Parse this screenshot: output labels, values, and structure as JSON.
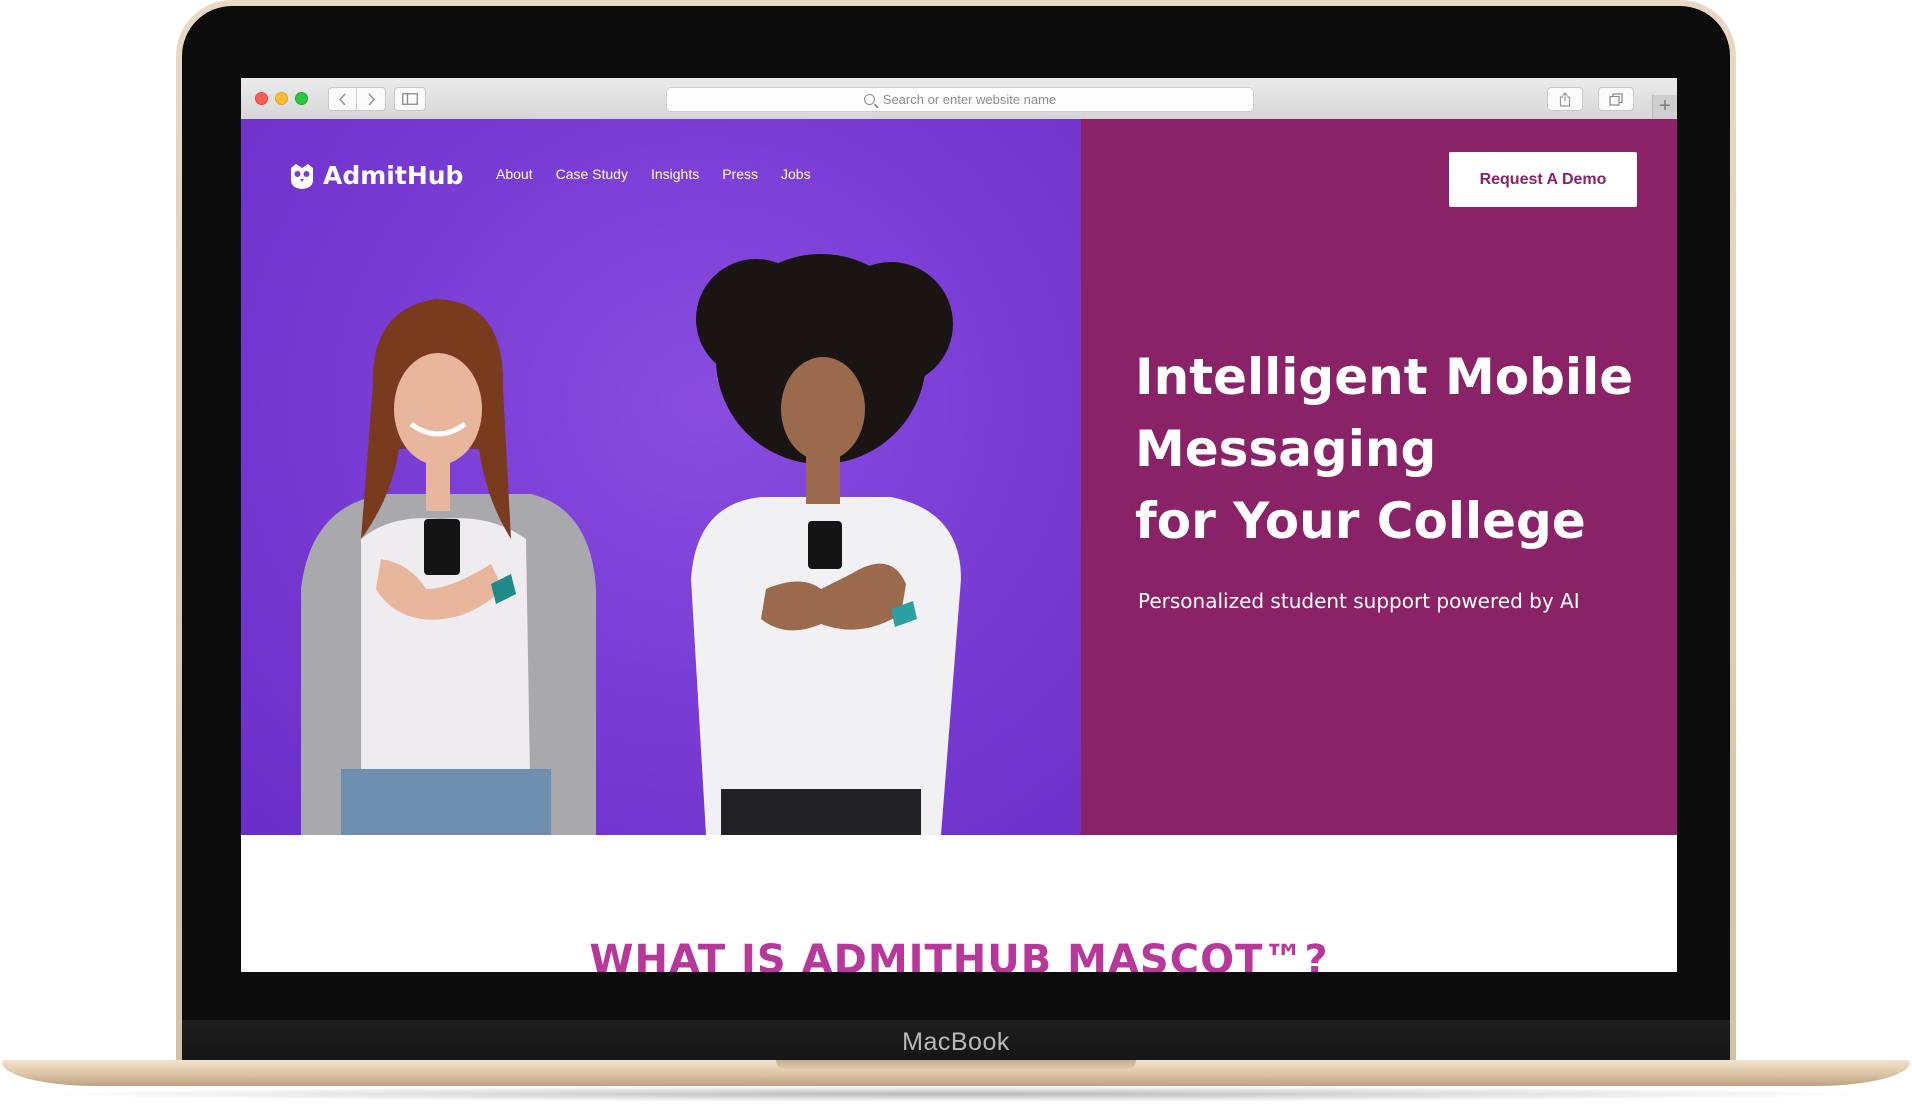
{
  "browser": {
    "address_placeholder": "Search or enter website name"
  },
  "site": {
    "logo_text": "AdmitHub",
    "nav": [
      "About",
      "Case Study",
      "Insights",
      "Press",
      "Jobs"
    ],
    "cta_label": "Request A Demo",
    "headline": [
      "Intelligent Mobile",
      "Messaging",
      "for Your College"
    ],
    "subheadline": "Personalized student support powered by AI",
    "section_title": "WHAT IS ADMITHUB MASCOT™?"
  },
  "device": {
    "brand_label": "MacBook"
  },
  "colors": {
    "hero_purple": "#7a3dd6",
    "hero_magenta": "#8a2268",
    "section_title_pink": "#b8379a",
    "laptop_gold": "#e1cdb1"
  }
}
